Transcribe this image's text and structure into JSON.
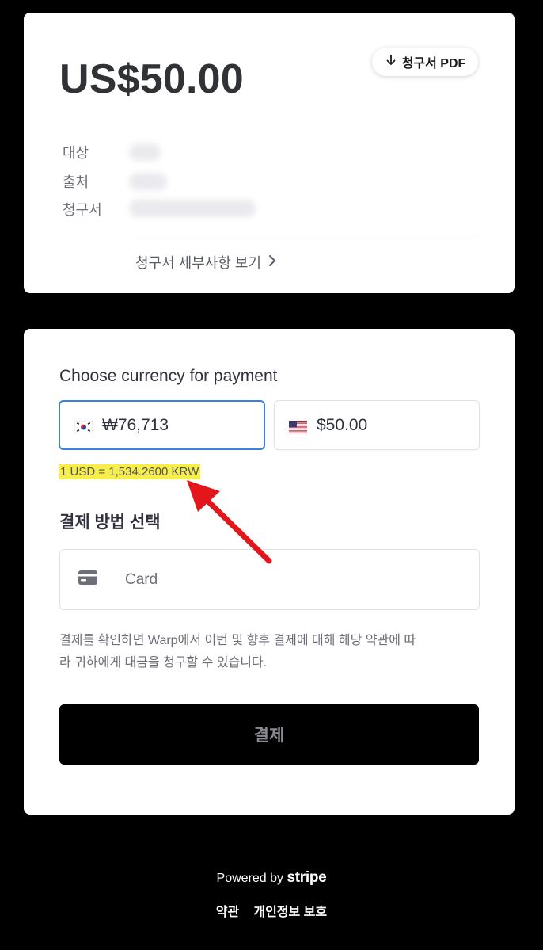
{
  "invoice": {
    "amount": "US$50.00",
    "pdf_button_label": "청구서 PDF",
    "meta_labels": [
      "대상",
      "출처",
      "청구서"
    ],
    "details_link": "청구서 세부사항 보기"
  },
  "payment": {
    "currency_title": "Choose currency for payment",
    "currencies": [
      {
        "code": "KRW",
        "amount": "₩76,713",
        "selected": true,
        "flag_icon": "kr-flag-icon"
      },
      {
        "code": "USD",
        "amount": "$50.00",
        "selected": false,
        "flag_icon": "us-flag-icon"
      }
    ],
    "exchange_rate": "1 USD = 1,534.2600 KRW",
    "method_title": "결제 방법 선택",
    "method_option": {
      "label": "Card",
      "icon": "credit-card-icon"
    },
    "terms_line1": "결제를 확인하면 Warp에서 이번 및 향후 결제에 대해 해당 약관에 따",
    "terms_line2": "라 귀하에게 대금을 청구할 수 있습니다.",
    "pay_button_label": "결제"
  },
  "footer": {
    "powered_by": "Powered by",
    "brand": "stripe",
    "links": [
      "약관",
      "개인정보 보호"
    ]
  },
  "colors": {
    "accent": "#3b7fe0",
    "highlight": "#f7ee4a",
    "annotation_arrow": "#e3161c"
  }
}
